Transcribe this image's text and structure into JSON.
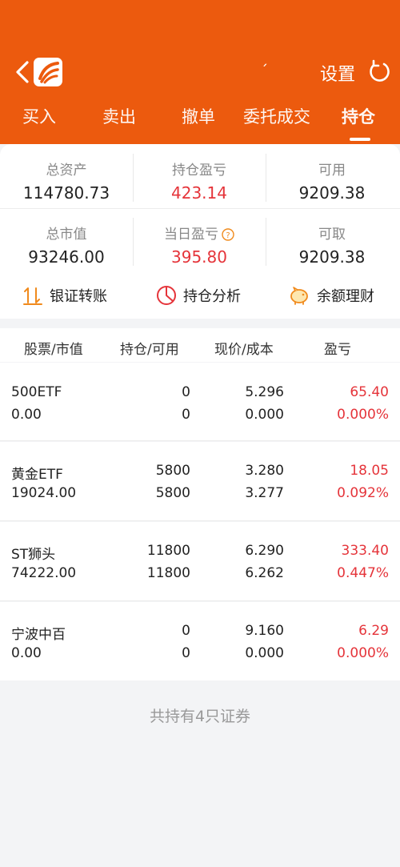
{
  "header": {
    "mark": "ˊ",
    "settings_label": "设置"
  },
  "tabs": [
    {
      "label": "买入"
    },
    {
      "label": "卖出"
    },
    {
      "label": "撤单"
    },
    {
      "label": "委托成交"
    },
    {
      "label": "持仓"
    }
  ],
  "summary": {
    "total_assets": {
      "label": "总资产",
      "value": "114780.73"
    },
    "position_pnl": {
      "label": "持仓盈亏",
      "value": "423.14"
    },
    "available": {
      "label": "可用",
      "value": "9209.38"
    },
    "market_value": {
      "label": "总市值",
      "value": "93246.00"
    },
    "daily_pnl": {
      "label": "当日盈亏",
      "value": "395.80"
    },
    "withdrawable": {
      "label": "可取",
      "value": "9209.38"
    }
  },
  "actions": {
    "transfer": "银证转账",
    "analysis": "持仓分析",
    "wealth": "余额理财"
  },
  "table": {
    "headers": [
      "股票/市值",
      "持仓/可用",
      "现价/成本",
      "盈亏"
    ],
    "rows": [
      {
        "name": "500ETF",
        "mv": "0.00",
        "hold": "0",
        "avail": "0",
        "price": "5.296",
        "cost": "0.000",
        "pnl": "65.40",
        "pct": "0.000%"
      },
      {
        "name": "黄金ETF",
        "mv": "19024.00",
        "hold": "5800",
        "avail": "5800",
        "price": "3.280",
        "cost": "3.277",
        "pnl": "18.05",
        "pct": "0.092%"
      },
      {
        "name": "ST狮头",
        "mv": "74222.00",
        "hold": "11800",
        "avail": "11800",
        "price": "6.290",
        "cost": "6.262",
        "pnl": "333.40",
        "pct": "0.447%"
      },
      {
        "name": "宁波中百",
        "mv": "0.00",
        "hold": "0",
        "avail": "0",
        "price": "9.160",
        "cost": "0.000",
        "pnl": "6.29",
        "pct": "0.000%"
      }
    ]
  },
  "footer": "共持有4只证券",
  "colors": {
    "brand": "#ec5a0e",
    "loss_gain_red": "#e5343a",
    "icon_orange": "#f08a1c"
  }
}
